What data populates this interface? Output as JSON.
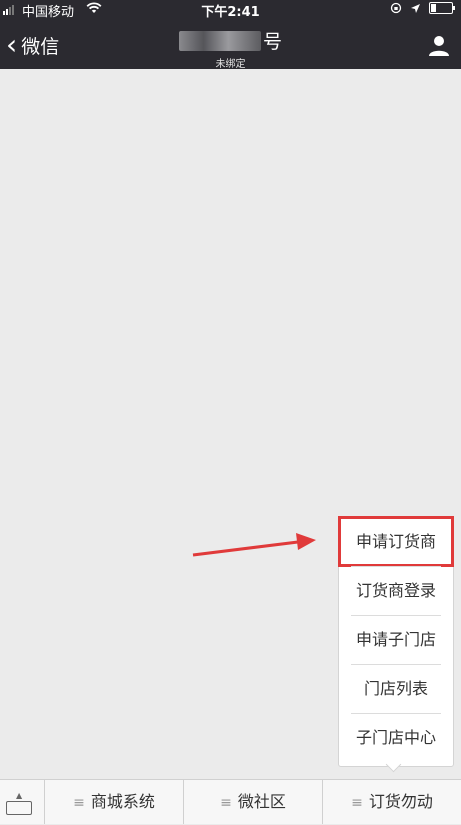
{
  "status_bar": {
    "carrier": "中国移动",
    "time": "下午2:41"
  },
  "nav": {
    "back_label": "微信",
    "title_visible": "号",
    "subtitle": "未绑定"
  },
  "menu": {
    "items": [
      "申请订货商",
      "订货商登录",
      "申请子门店",
      "门店列表",
      "子门店中心"
    ],
    "highlighted_index": 0
  },
  "bottom_bar": {
    "tabs": [
      "商城系统",
      "微社区",
      "订货勿动"
    ],
    "menu_glyph": "≡"
  },
  "colors": {
    "nav_bg": "#2b2a30",
    "page_bg": "#ebebeb",
    "highlight": "#e03a3a"
  }
}
